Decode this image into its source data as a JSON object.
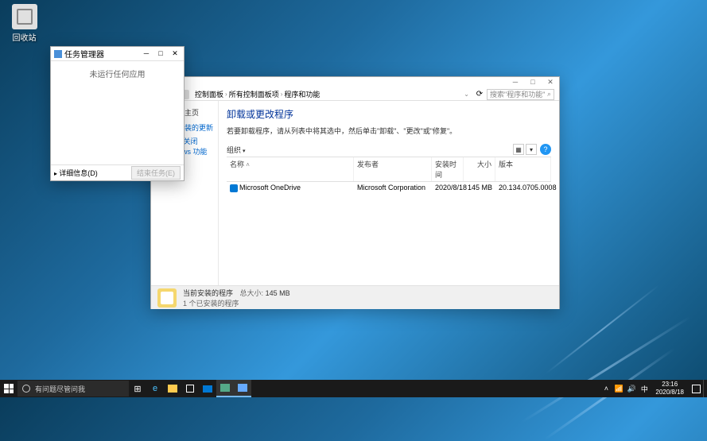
{
  "desktop": {
    "recycle_bin": "回收站"
  },
  "taskmgr": {
    "title": "任务管理器",
    "empty_msg": "未运行任何应用",
    "details_btn": "详细信息(D)",
    "endtask_btn": "结束任务(E)"
  },
  "cpanel": {
    "breadcrumb": {
      "a": "控制面板",
      "b": "所有控制面板项",
      "c": "程序和功能"
    },
    "search_placeholder": "搜索\"程序和功能\"",
    "sidebar": {
      "heading": "控制面板主页",
      "link1": "查看已安装的更新",
      "link2": "启用或关闭 Windows 功能"
    },
    "main": {
      "heading": "卸载或更改程序",
      "subtext": "若要卸载程序，请从列表中将其选中，然后单击\"卸载\"、\"更改\"或\"修复\"。",
      "organize": "组织"
    },
    "columns": {
      "name": "名称",
      "publisher": "发布者",
      "installed": "安装时间",
      "size": "大小",
      "version": "版本"
    },
    "rows": [
      {
        "name": "Microsoft OneDrive",
        "publisher": "Microsoft Corporation",
        "installed": "2020/8/18",
        "size": "145 MB",
        "version": "20.134.0705.0008"
      }
    ],
    "status": {
      "title": "当前安装的程序",
      "size_label": "总大小:",
      "size_value": "145 MB",
      "count": "1 个已安装的程序"
    }
  },
  "taskbar": {
    "search_placeholder": "有问题尽管问我",
    "ime": "中",
    "time": "23:16",
    "date": "2020/8/18"
  }
}
